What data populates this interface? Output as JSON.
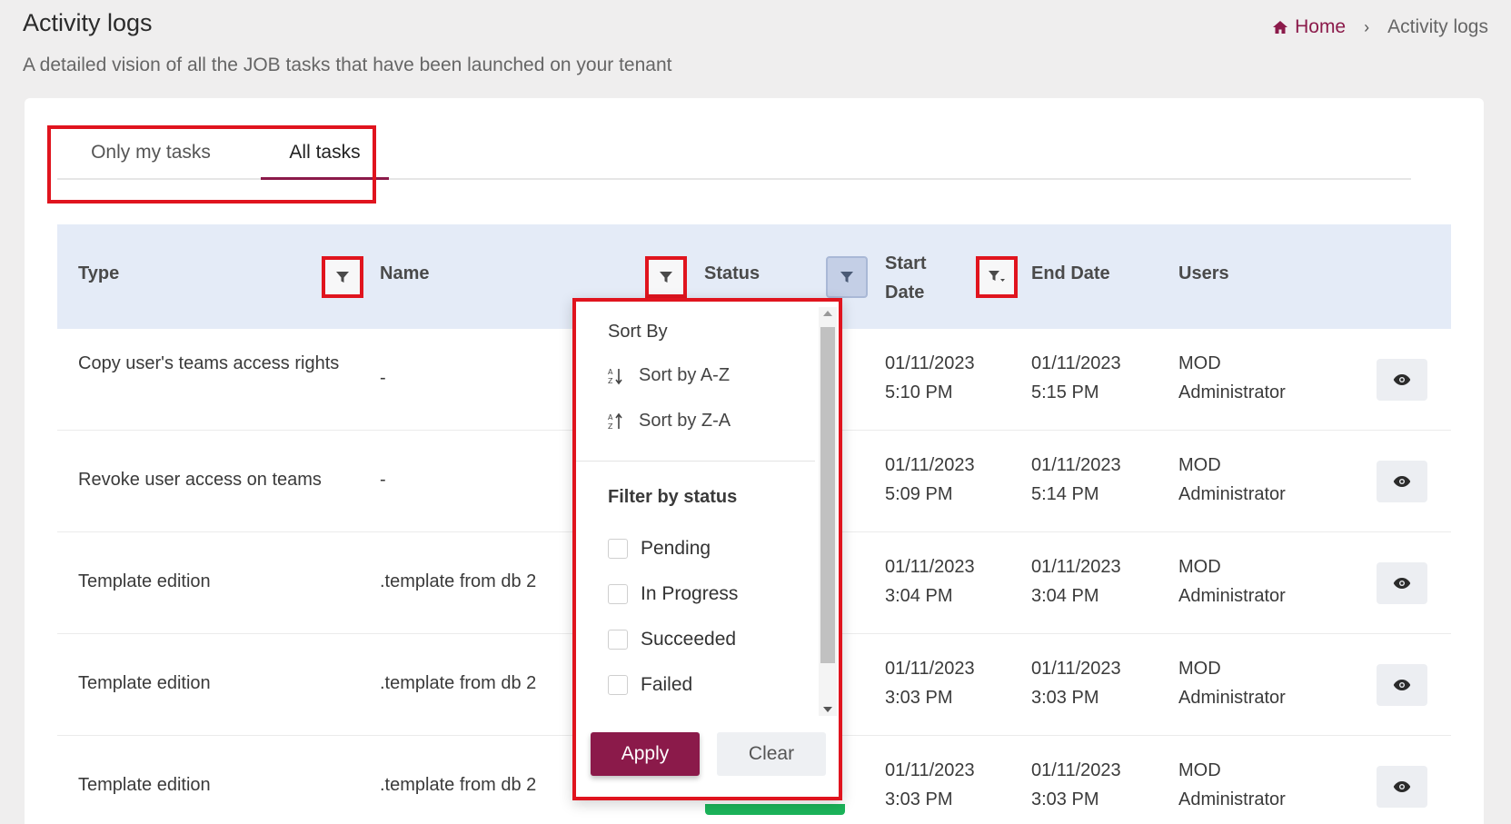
{
  "header": {
    "title": "Activity logs",
    "subtitle": "A detailed vision of all the JOB tasks that have been launched on your tenant"
  },
  "breadcrumb": {
    "home": "Home",
    "separator": "›",
    "current": "Activity logs"
  },
  "tabs": [
    {
      "label": "Only my tasks",
      "active": false
    },
    {
      "label": "All tasks",
      "active": true
    }
  ],
  "table": {
    "columns": {
      "type": "Type",
      "name": "Name",
      "status": "Status",
      "start_date": "Start Date",
      "end_date": "End Date",
      "users": "Users"
    },
    "rows": [
      {
        "type": "Copy user's teams access rights",
        "name": "-",
        "start": "01/11/2023 5:10 PM",
        "end": "01/11/2023 5:15 PM",
        "users": "MOD Administrator"
      },
      {
        "type": "Revoke user access on teams",
        "name": "-",
        "start": "01/11/2023 5:09 PM",
        "end": "01/11/2023 5:14 PM",
        "users": "MOD Administrator"
      },
      {
        "type": "Template edition",
        "name": ".template from db 2",
        "start": "01/11/2023 3:04 PM",
        "end": "01/11/2023 3:04 PM",
        "users": "MOD Administrator"
      },
      {
        "type": "Template edition",
        "name": ".template from db 2",
        "start": "01/11/2023 3:03 PM",
        "end": "01/11/2023 3:03 PM",
        "users": "MOD Administrator"
      },
      {
        "type": "Template edition",
        "name": ".template from db 2",
        "start": "01/11/2023 3:03 PM",
        "end": "01/11/2023 3:03 PM",
        "users": "MOD Administrator"
      }
    ]
  },
  "dropdown": {
    "sort_title": "Sort By",
    "sort_az": "Sort by A-Z",
    "sort_za": "Sort by Z-A",
    "filter_title": "Filter by status",
    "options": [
      "Pending",
      "In Progress",
      "Succeeded",
      "Failed"
    ],
    "apply": "Apply",
    "clear": "Clear"
  },
  "colors": {
    "brand": "#8b1a4a",
    "highlight": "#e0141e",
    "header_bg": "#e4ebf7",
    "success": "#1bb45a"
  },
  "icons": {
    "home": "home-icon",
    "filter": "filter-icon",
    "filter_sort": "filter-sort-icon",
    "view": "eye-icon",
    "sort_az": "sort-az-icon",
    "sort_za": "sort-za-icon"
  }
}
